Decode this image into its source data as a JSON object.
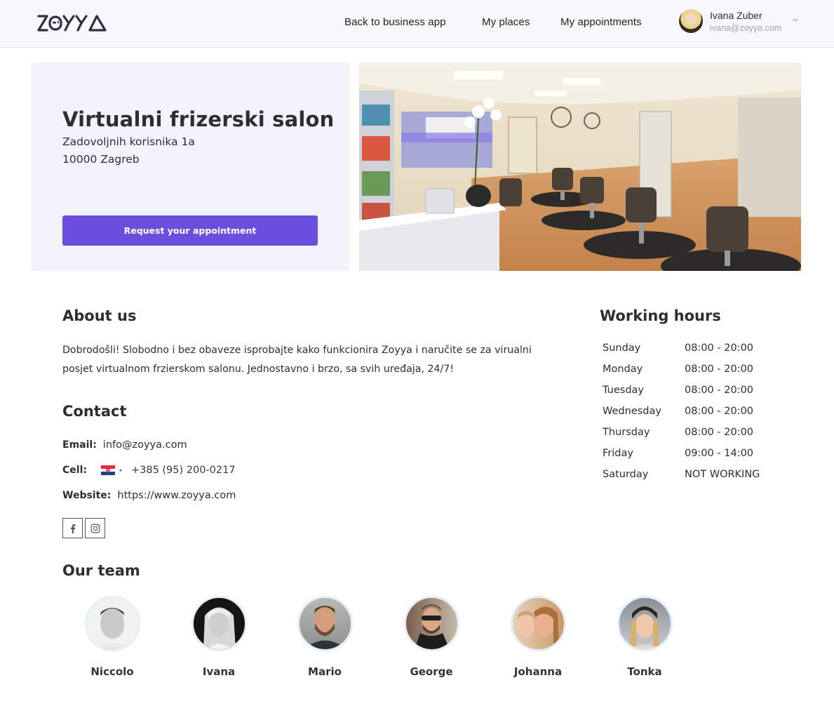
{
  "header": {
    "logo_text": "ZOYYA",
    "nav": [
      {
        "label": "Back to business app"
      },
      {
        "label": "My places"
      },
      {
        "label": "My appointments"
      }
    ],
    "user": {
      "name": "Ivana Zuber",
      "email": "ivana@zoyya.com"
    }
  },
  "hero": {
    "title": "Virtualni frizerski salon",
    "address_line1": "Zadovoljnih korisnika 1a",
    "address_line2": "10000 Zagreb",
    "request_button": "Request your appointment",
    "photo_alt": "Hair salon interior"
  },
  "about": {
    "title": "About us",
    "text": "Dobrodošli! Slobodno i bez obaveze isprobajte kako funkcionira Zoyya i naručite se za virualni posjet virtualnom frzierskom salonu. Jednostavno i brzo, sa svih uređaja, 24/7!"
  },
  "contact": {
    "title": "Contact",
    "email_label": "Email:",
    "email": "info@zoyya.com",
    "cell_label": "Cell:",
    "cell_country": "HR",
    "cell": "+385 (95) 200-0217",
    "website_label": "Website:",
    "website": "https://www.zoyya.com",
    "social": [
      {
        "icon": "facebook-icon"
      },
      {
        "icon": "instagram-icon"
      }
    ]
  },
  "working_hours": {
    "title": "Working hours",
    "days": [
      {
        "day": "Sunday",
        "hours": "08:00 - 20:00"
      },
      {
        "day": "Monday",
        "hours": "08:00 - 20:00"
      },
      {
        "day": "Tuesday",
        "hours": "08:00 - 20:00"
      },
      {
        "day": "Wednesday",
        "hours": "08:00 - 20:00"
      },
      {
        "day": "Thursday",
        "hours": "08:00 - 20:00"
      },
      {
        "day": "Friday",
        "hours": "09:00 - 14:00"
      },
      {
        "day": "Saturday",
        "hours": "NOT WORKING"
      }
    ]
  },
  "team": {
    "title": "Our team",
    "members": [
      {
        "name": "Niccolo"
      },
      {
        "name": "Ivana"
      },
      {
        "name": "Mario"
      },
      {
        "name": "George"
      },
      {
        "name": "Johanna"
      },
      {
        "name": "Tonka"
      }
    ]
  },
  "colors": {
    "accent": "#6a4fde",
    "hero_bg": "#f3f3fe",
    "header_bg": "#f8f8fc",
    "avatar_ring": "#e3eefd"
  }
}
